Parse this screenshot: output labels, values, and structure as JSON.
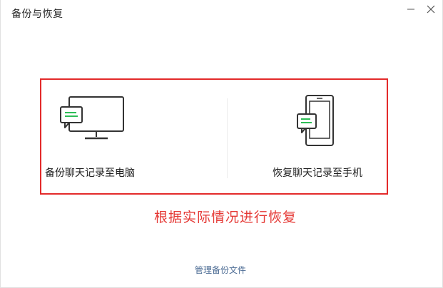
{
  "window": {
    "title": "备份与恢复",
    "minimize_icon": "minimize-icon",
    "close_icon": "close-icon"
  },
  "options": {
    "backup": {
      "label": "备份聊天记录至电脑",
      "icon": "monitor-chat-icon"
    },
    "restore": {
      "label": "恢复聊天记录至手机",
      "icon": "phone-chat-icon"
    }
  },
  "annotation": {
    "text": "根据实际情况进行恢复",
    "color": "#e53935"
  },
  "footer": {
    "manage_link": "管理备份文件"
  },
  "colors": {
    "accent_green": "#2dbd56",
    "highlight_red": "#e32a2a",
    "link_blue": "#4a6a93"
  }
}
